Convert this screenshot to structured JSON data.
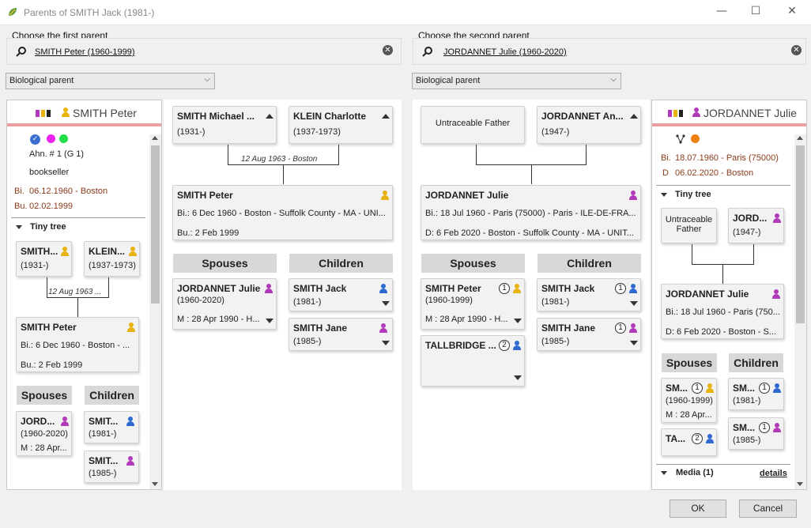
{
  "window": {
    "title": "Parents of SMITH Jack (1981-)",
    "min": "—",
    "max": "☐",
    "close": "✕"
  },
  "first": {
    "label": "Choose the first parent",
    "value": "SMITH Peter (1960-1999)",
    "type": "Biological parent"
  },
  "second": {
    "label": "Choose the second parent",
    "value": "JORDANNET Julie (1960-2020)",
    "type": "Biological parent"
  },
  "left_side": {
    "name": "SMITH Peter",
    "ahn": "Ahn. # 1 (G 1)",
    "occupation": "bookseller",
    "birth_lbl": "Bi.",
    "birth": "06.12.1960 - Boston",
    "burial_lbl": "Bu.",
    "burial": "02.02.1999",
    "tiny_tree": "Tiny tree",
    "father": {
      "name": "SMITH...",
      "dates": "(1931-)"
    },
    "mother": {
      "name": "KLEIN...",
      "dates": "(1937-1973)"
    },
    "marriage": "12 Aug 1963 ...",
    "self": {
      "name": "SMITH Peter",
      "birth": "Bi.: 6 Dec 1960 - Boston - ...",
      "burial": "Bu.: 2 Feb 1999"
    },
    "spouses_hdr": "Spouses",
    "children_hdr": "Children",
    "spouse": {
      "name": "JORD...",
      "dates": "(1960-2020)",
      "marr": "M : 28 Apr..."
    },
    "child1": {
      "name": "SMIT...",
      "dates": "(1981-)"
    },
    "child2": {
      "name": "SMIT...",
      "dates": "(1985-)"
    }
  },
  "left_main": {
    "father": {
      "name": "SMITH Michael ...",
      "dates": "(1931-)"
    },
    "mother": {
      "name": "KLEIN Charlotte",
      "dates": "(1937-1973)"
    },
    "marriage": "12 Aug 1963 - Boston",
    "self": {
      "name": "SMITH Peter",
      "birth": "Bi.: 6 Dec 1960 - Boston - Suffolk County - MA - UNI...",
      "burial": "Bu.: 2 Feb 1999"
    },
    "spouses_hdr": "Spouses",
    "children_hdr": "Children",
    "spouse": {
      "name": "JORDANNET Julie",
      "dates": "(1960-2020)",
      "marr": "M : 28 Apr 1990 - H..."
    },
    "child1": {
      "name": "SMITH Jack",
      "dates": "(1981-)"
    },
    "child2": {
      "name": "SMITH Jane",
      "dates": "(1985-)"
    }
  },
  "right_main": {
    "father": {
      "name": "Untraceable Father"
    },
    "mother": {
      "name": "JORDANNET An...",
      "dates": "(1947-)"
    },
    "self": {
      "name": "JORDANNET Julie",
      "birth": "Bi.: 18 Jul 1960 - Paris (75000) - Paris - ILE-DE-FRA...",
      "death": "D: 6 Feb 2020 - Boston - Suffolk County - MA - UNIT..."
    },
    "spouses_hdr": "Spouses",
    "children_hdr": "Children",
    "spouse1": {
      "name": "SMITH Peter",
      "num": "1",
      "dates": "(1960-1999)",
      "marr": "M : 28 Apr 1990 - H..."
    },
    "spouse2": {
      "name": "TALLBRIDGE ...",
      "num": "2"
    },
    "child1": {
      "name": "SMITH Jack",
      "num": "1",
      "dates": "(1981-)"
    },
    "child2": {
      "name": "SMITH Jane",
      "num": "1",
      "dates": "(1985-)"
    }
  },
  "right_side": {
    "name": "JORDANNET Julie",
    "birth_lbl": "Bi.",
    "birth": "18.07.1960 - Paris (75000)",
    "death_lbl": "D",
    "death": "06.02.2020 - Boston",
    "tiny_tree": "Tiny tree",
    "father": {
      "name": "Untraceable Father"
    },
    "mother": {
      "name": "JORD...",
      "dates": "(1947-)"
    },
    "self": {
      "name": "JORDANNET Julie",
      "birth": "Bi.: 18 Jul 1960 - Paris (750...",
      "death": "D: 6 Feb 2020 - Boston - S..."
    },
    "spouses_hdr": "Spouses",
    "children_hdr": "Children",
    "spouse1": {
      "name": "SM...",
      "num": "1",
      "dates": "(1960-1999)",
      "marr": "M : 28 Apr..."
    },
    "spouse2": {
      "name": "TA...",
      "num": "2"
    },
    "child1": {
      "name": "SM...",
      "num": "1",
      "dates": "(1981-)"
    },
    "child2": {
      "name": "SM...",
      "num": "1",
      "dates": "(1985-)"
    },
    "media": "Media (1)",
    "details": "details"
  },
  "buttons": {
    "ok": "OK",
    "cancel": "Cancel"
  },
  "colors": {
    "accent_red": "#e8a0a0",
    "female": "#b03ab8",
    "male": "#2e6ad0",
    "unknown": "#e8b20f"
  }
}
